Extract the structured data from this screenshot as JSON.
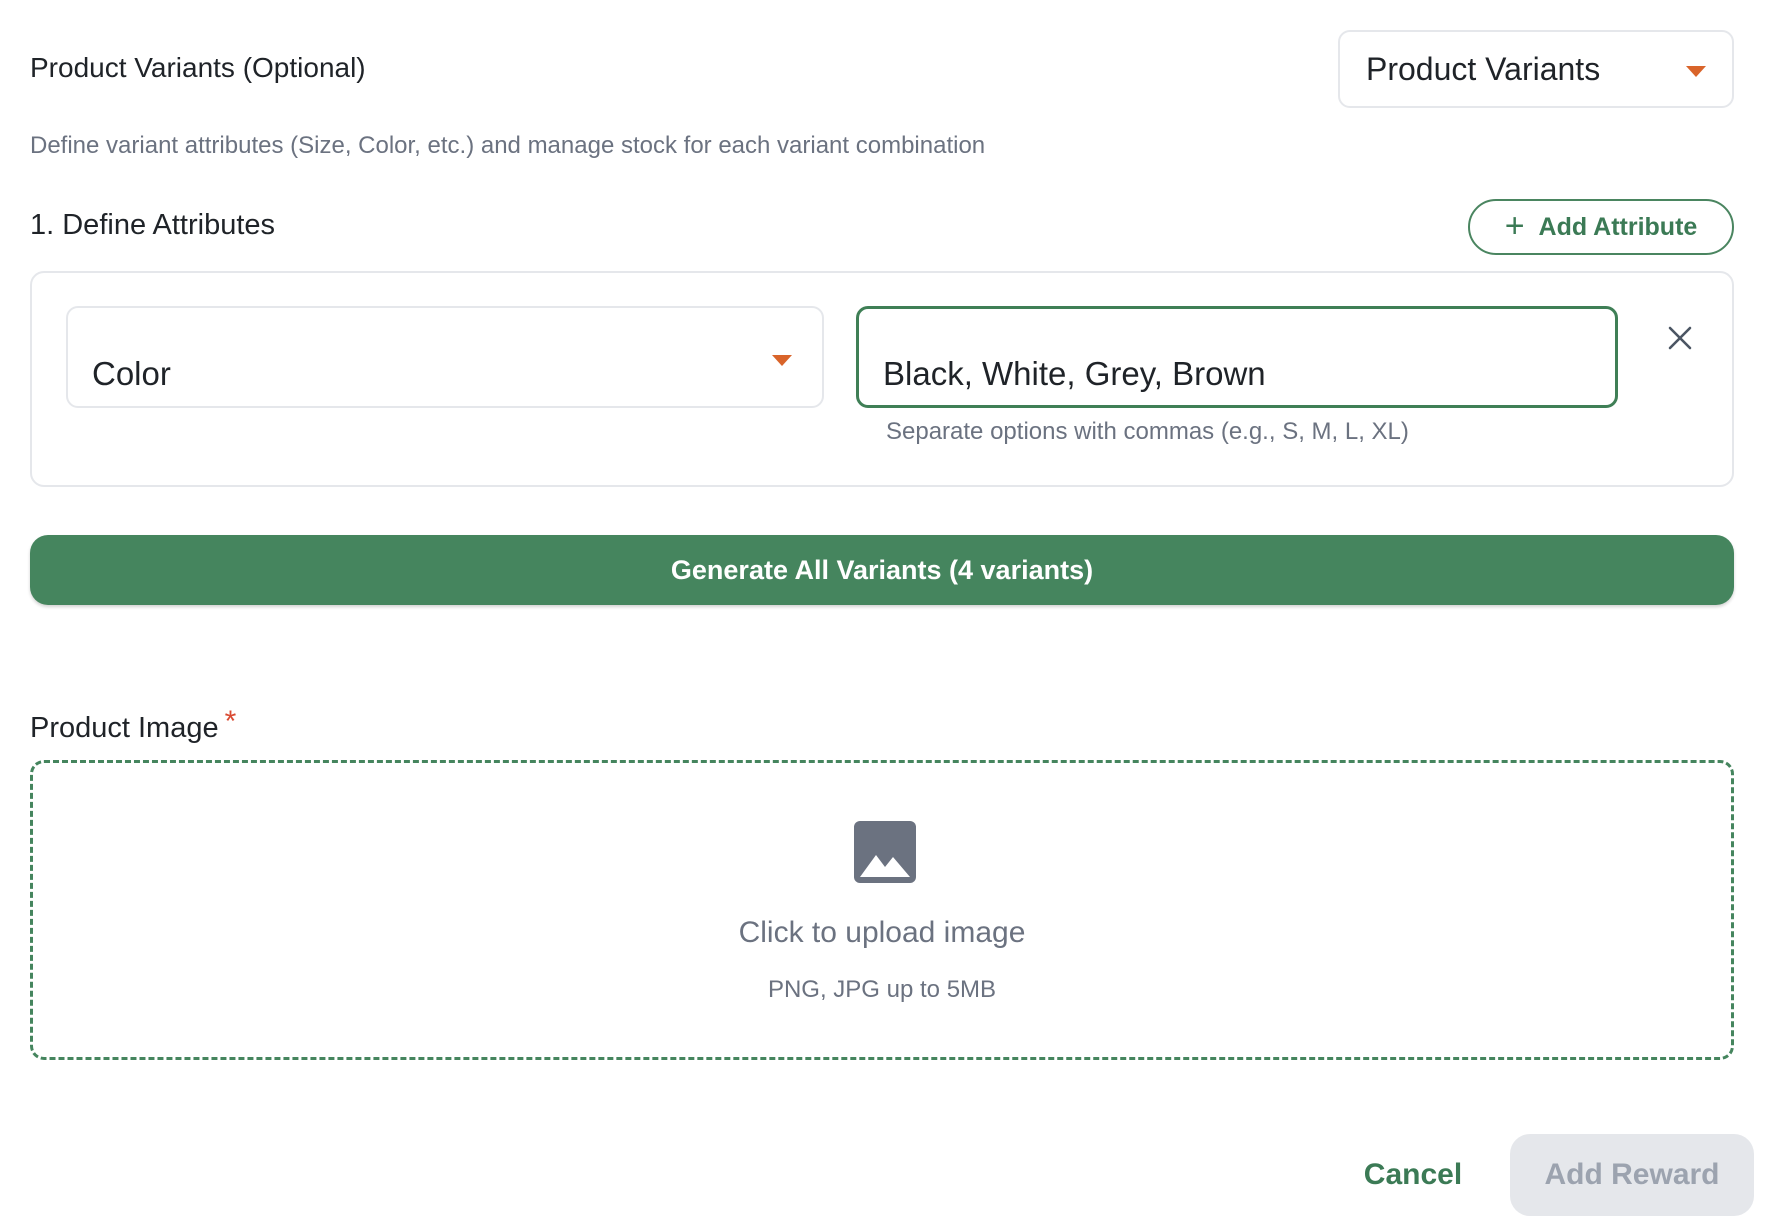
{
  "variants": {
    "section_title": "Product Variants (Optional)",
    "selector_label": "Product Variants",
    "subtitle": "Define variant attributes (Size, Color, etc.) and manage stock for each variant combination",
    "step_title": "1. Define Attributes",
    "add_attribute_label": "Add Attribute",
    "attribute": {
      "type": "Color",
      "options_value": "Black, White, Grey, Brown",
      "helper": "Separate options with commas (e.g., S, M, L, XL)"
    },
    "generate_label": "Generate All Variants (4 variants)"
  },
  "product_image": {
    "title": "Product Image",
    "required_mark": "*",
    "upload_text": "Click to upload image",
    "upload_hint": "PNG, JPG up to 5MB"
  },
  "footer": {
    "cancel_label": "Cancel",
    "submit_label": "Add Reward"
  },
  "icons": {
    "add": "plus-icon",
    "remove": "close-icon",
    "dropdown": "chevron-down-icon",
    "upload": "image-icon"
  },
  "colors": {
    "primary": "#45855e",
    "accent_caret": "#d9642a",
    "required": "#d94a32",
    "disabled_bg": "#e5e7eb"
  }
}
